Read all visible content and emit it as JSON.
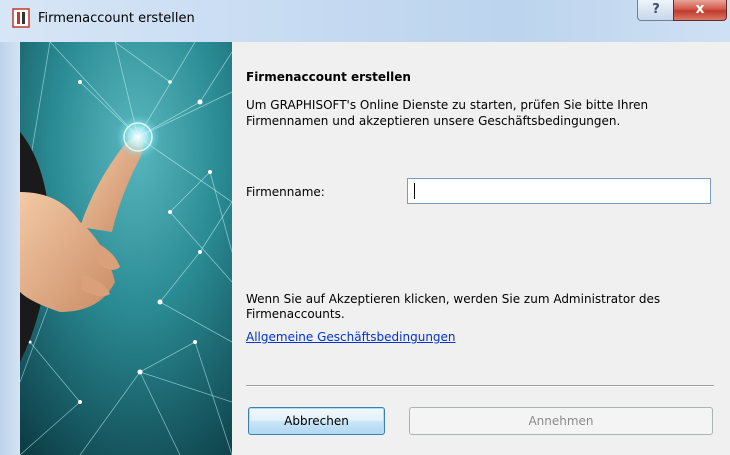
{
  "window": {
    "title": "Firmenaccount erstellen",
    "help_button": "?",
    "close_button": "x"
  },
  "hero": {
    "icon": "fingertip-touch-network-image"
  },
  "main": {
    "heading": "Firmenaccount erstellen",
    "description": "Um GRAPHISOFT's Online Dienste zu starten, prüfen Sie bitte Ihren Firmennamen und akzeptieren unsere Geschäftsbedingungen.",
    "company_label": "Firmenname:",
    "company_value": "",
    "note": "Wenn Sie auf Akzeptieren klicken, werden Sie zum Administrator des Firmenaccounts.",
    "terms_link": "Allgemeine Geschäftsbedingungen"
  },
  "buttons": {
    "cancel": "Abbrechen",
    "accept": "Annehmen"
  },
  "colors": {
    "link": "#0033cc",
    "close_red": "#c03a2b",
    "hero_teal": "#2a8a93"
  }
}
